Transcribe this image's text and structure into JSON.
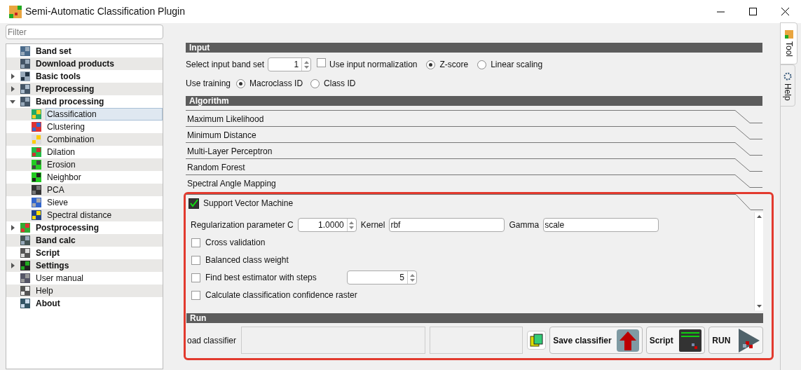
{
  "window": {
    "title": "Semi-Automatic Classification Plugin"
  },
  "filter": {
    "placeholder": "Filter"
  },
  "tree": [
    {
      "label": "Band set",
      "bold": true,
      "selected": false
    },
    {
      "label": "Download products",
      "bold": true,
      "selected": false
    },
    {
      "label": "Basic tools",
      "bold": true,
      "selected": false,
      "expanded": false
    },
    {
      "label": "Preprocessing",
      "bold": true,
      "selected": false,
      "expanded": false
    },
    {
      "label": "Band processing",
      "bold": true,
      "selected": false,
      "expanded": true,
      "children": [
        {
          "label": "Classification",
          "bold": false,
          "selected": true
        },
        {
          "label": "Clustering",
          "bold": false,
          "selected": false
        },
        {
          "label": "Combination",
          "bold": false,
          "selected": false
        },
        {
          "label": "Dilation",
          "bold": false,
          "selected": false
        },
        {
          "label": "Erosion",
          "bold": false,
          "selected": false
        },
        {
          "label": "Neighbor",
          "bold": false,
          "selected": false
        },
        {
          "label": "PCA",
          "bold": false,
          "selected": false
        },
        {
          "label": "Sieve",
          "bold": false,
          "selected": false
        },
        {
          "label": "Spectral distance",
          "bold": false,
          "selected": false
        }
      ]
    },
    {
      "label": "Postprocessing",
      "bold": true,
      "selected": false,
      "expanded": false
    },
    {
      "label": "Band calc",
      "bold": true,
      "selected": false
    },
    {
      "label": "Script",
      "bold": true,
      "selected": false
    },
    {
      "label": "Settings",
      "bold": true,
      "selected": false,
      "expanded": false
    },
    {
      "label": "User manual",
      "bold": false,
      "selected": false
    },
    {
      "label": "Help",
      "bold": false,
      "selected": false
    },
    {
      "label": "About",
      "bold": true,
      "selected": false
    }
  ],
  "side_tabs": [
    {
      "label": "Tool",
      "selected": true
    },
    {
      "label": "Help",
      "selected": false
    }
  ],
  "input": {
    "title": "Input",
    "band_set_label": "Select input band set",
    "band_set": "1",
    "normalization": {
      "label": "Use input normalization",
      "checked": false
    },
    "normalization_modes": [
      {
        "label": "Z-score",
        "selected": true
      },
      {
        "label": "Linear scaling",
        "selected": false
      }
    ],
    "training_label": "Use training",
    "training_modes": [
      {
        "label": "Macroclass ID",
        "selected": true
      },
      {
        "label": "Class ID",
        "selected": false
      }
    ]
  },
  "algorithm": {
    "title": "Algorithm",
    "items": [
      {
        "label": "Maximum Likelihood",
        "expanded": false
      },
      {
        "label": "Minimum Distance",
        "expanded": false
      },
      {
        "label": "Multi-Layer Perceptron",
        "expanded": false
      },
      {
        "label": "Random Forest",
        "expanded": false
      },
      {
        "label": "Spectral Angle Mapping",
        "expanded": false
      },
      {
        "label": "Support Vector Machine",
        "expanded": true,
        "checked": true
      }
    ]
  },
  "svm": {
    "regularization_label": "Regularization parameter C",
    "regularization": "1.0000",
    "kernel_label": "Kernel",
    "kernel": "rbf",
    "gamma_label": "Gamma",
    "gamma": "scale",
    "options": [
      {
        "label": "Cross validation",
        "checked": false
      },
      {
        "label": "Balanced class weight",
        "checked": false
      },
      {
        "label": "Find best estimator with steps",
        "checked": false,
        "steps": "5"
      },
      {
        "label": "Calculate classification confidence raster",
        "checked": false
      }
    ]
  },
  "run": {
    "title": "Run",
    "load_label": "oad classifier",
    "buttons": [
      {
        "kind": "save",
        "label": "Save classifier"
      },
      {
        "kind": "script",
        "label": "Script"
      },
      {
        "kind": "run",
        "label": "RUN"
      }
    ]
  }
}
